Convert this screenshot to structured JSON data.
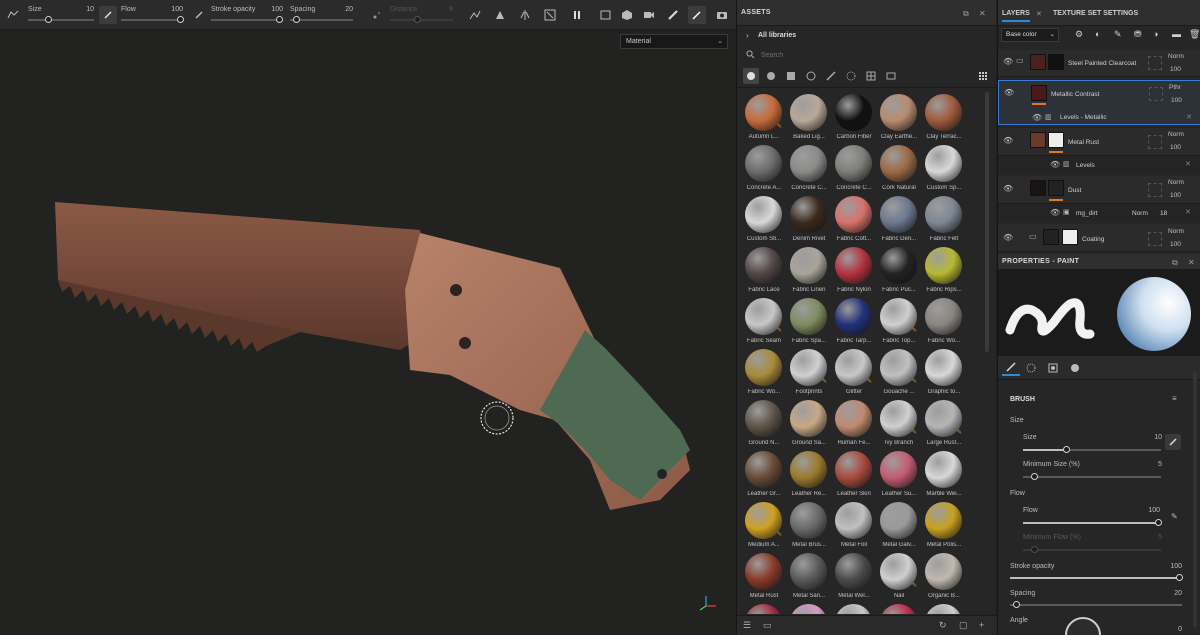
{
  "toolbar": {
    "size": {
      "label": "Size",
      "value": "10",
      "level": 0.15
    },
    "flow": {
      "label": "Flow",
      "value": "100",
      "level": 1.0
    },
    "stroke_opacity": {
      "label": "Stroke opacity",
      "value": "100",
      "level": 1.0
    },
    "spacing": {
      "label": "Spacing",
      "value": "20",
      "level": 0.05
    },
    "distance": {
      "label": "Distance",
      "value": "8",
      "level": 0.4
    }
  },
  "viewport": {
    "material_select": "Material"
  },
  "assets": {
    "title": "ASSETS",
    "library": "All libraries",
    "search_placeholder": "Search",
    "items": [
      {
        "name": "Autumn L...",
        "color": "#c86a3a",
        "badge": true
      },
      {
        "name": "Baked Lig...",
        "color": "#b8a898"
      },
      {
        "name": "Carbon Fiber",
        "color": "#111111"
      },
      {
        "name": "Clay Earthe...",
        "color": "#b98b6e"
      },
      {
        "name": "Clay Terrac...",
        "color": "#a05a3c"
      },
      {
        "name": "Concrete A...",
        "color": "#6c6c6c"
      },
      {
        "name": "Concrete C...",
        "color": "#8a8a88"
      },
      {
        "name": "Concrete C...",
        "color": "#7d7d78"
      },
      {
        "name": "Cork Natural",
        "color": "#9c6a45"
      },
      {
        "name": "Custom Sp...",
        "color": "#d8d8d8"
      },
      {
        "name": "Custom Sti...",
        "color": "#d8d8d8"
      },
      {
        "name": "Denim Rivet",
        "color": "#3a2a1e"
      },
      {
        "name": "Fabric Cott...",
        "color": "#d9716b"
      },
      {
        "name": "Fabric Den...",
        "color": "#6c7890"
      },
      {
        "name": "Fabric Felt",
        "color": "#7e8794"
      },
      {
        "name": "Fabric Lace",
        "color": "#524745"
      },
      {
        "name": "Fabric Linen",
        "color": "#a9a39a"
      },
      {
        "name": "Fabric Nylon",
        "color": "#b5333f"
      },
      {
        "name": "Fabric Puc...",
        "color": "#222222"
      },
      {
        "name": "Fabric Rips...",
        "color": "#b8b832"
      },
      {
        "name": "Fabric Seam",
        "color": "#c8c8c8",
        "badge": true
      },
      {
        "name": "Fabric Spa...",
        "color": "#7e8c5e"
      },
      {
        "name": "Fabric Tarp...",
        "color": "#22327a"
      },
      {
        "name": "Fabric Top...",
        "color": "#cfcfcf",
        "badge": true
      },
      {
        "name": "Fabric Wo...",
        "color": "#8a8580"
      },
      {
        "name": "Fabric Wo...",
        "color": "#a88a3a"
      },
      {
        "name": "Footprints",
        "color": "#d0d0d0",
        "badge": true
      },
      {
        "name": "Glitter",
        "color": "#c8c8c8",
        "badge": true
      },
      {
        "name": "Gouache ...",
        "color": "#c0c0c0",
        "badge": true
      },
      {
        "name": "Graphic to...",
        "color": "#d8d8d8"
      },
      {
        "name": "Ground N...",
        "color": "#5e5448"
      },
      {
        "name": "Ground Sa...",
        "color": "#c7a883"
      },
      {
        "name": "Human Fe...",
        "color": "#c08a70"
      },
      {
        "name": "Ivy Branch",
        "color": "#d0d0d0",
        "badge": true
      },
      {
        "name": "Large Rust...",
        "color": "#b5b5b5",
        "badge": true
      },
      {
        "name": "Leather Gr...",
        "color": "#6a4a35"
      },
      {
        "name": "Leather Re...",
        "color": "#9a7a2a"
      },
      {
        "name": "Leather Skin",
        "color": "#a84a3e"
      },
      {
        "name": "Leather Su...",
        "color": "#c55a72"
      },
      {
        "name": "Marble Wei...",
        "color": "#d8d8d8"
      },
      {
        "name": "Medium A...",
        "color": "#d0a020",
        "badge": true
      },
      {
        "name": "Metal Brus...",
        "color": "#6a6a6a"
      },
      {
        "name": "Metal Foil",
        "color": "#c0c0c0"
      },
      {
        "name": "Metal Galv...",
        "color": "#9a9a9a"
      },
      {
        "name": "Metal Polis...",
        "color": "#c8a020"
      },
      {
        "name": "Metal Rust",
        "color": "#8a3a2a"
      },
      {
        "name": "Metal San...",
        "color": "#5a5a5a"
      },
      {
        "name": "Metal Wel...",
        "color": "#4a4a4a"
      },
      {
        "name": "Nail",
        "color": "#d0d0d0",
        "badge": true
      },
      {
        "name": "Organic B...",
        "color": "#c0b8b0"
      },
      {
        "name": "",
        "color": "#a02a3a"
      },
      {
        "name": "",
        "color": "#d898c8"
      },
      {
        "name": "",
        "color": "#c8c8c8"
      },
      {
        "name": "",
        "color": "#c02a4a"
      },
      {
        "name": "",
        "color": "#d0d0d0"
      }
    ]
  },
  "layers": {
    "tab_layers": "LAYERS",
    "tab_texture_sets": "TEXTURE SET SETTINGS",
    "channel": "Base color",
    "items": [
      {
        "name": "Steel Painted Clearcoat",
        "blend": "Norm",
        "opacity": "100"
      },
      {
        "name": "Metallic Contrast",
        "blend": "Pthr",
        "opacity": "100",
        "sub": "Levels - Metallic"
      },
      {
        "name": "Metal Rust",
        "blend": "Norm",
        "opacity": "100",
        "sub": "Levels"
      },
      {
        "name": "Dust",
        "blend": "Norm",
        "opacity": "100",
        "sub": "mg_dirt",
        "sub_blend": "Norm",
        "sub_opacity": "18"
      },
      {
        "name": "Coating",
        "blend": "Norm",
        "opacity": "100"
      }
    ]
  },
  "properties": {
    "title": "PROPERTIES - PAINT",
    "section_brush": "BRUSH",
    "group_size": "Size",
    "size": {
      "label": "Size",
      "value": "10"
    },
    "min_size": {
      "label": "Minimum Size (%)",
      "value": "5"
    },
    "group_flow": "Flow",
    "flow": {
      "label": "Flow",
      "value": "100"
    },
    "min_flow": {
      "label": "Minimum Flow (%)",
      "value": "5"
    },
    "stroke_opacity": {
      "label": "Stroke opacity",
      "value": "100"
    },
    "spacing": {
      "label": "Spacing",
      "value": "20"
    },
    "angle": {
      "label": "Angle",
      "value": "0"
    }
  },
  "colors": {
    "accent": "#2f8ad6",
    "opacity_bar": "#e07a1e",
    "badge": "#e08a2a"
  }
}
